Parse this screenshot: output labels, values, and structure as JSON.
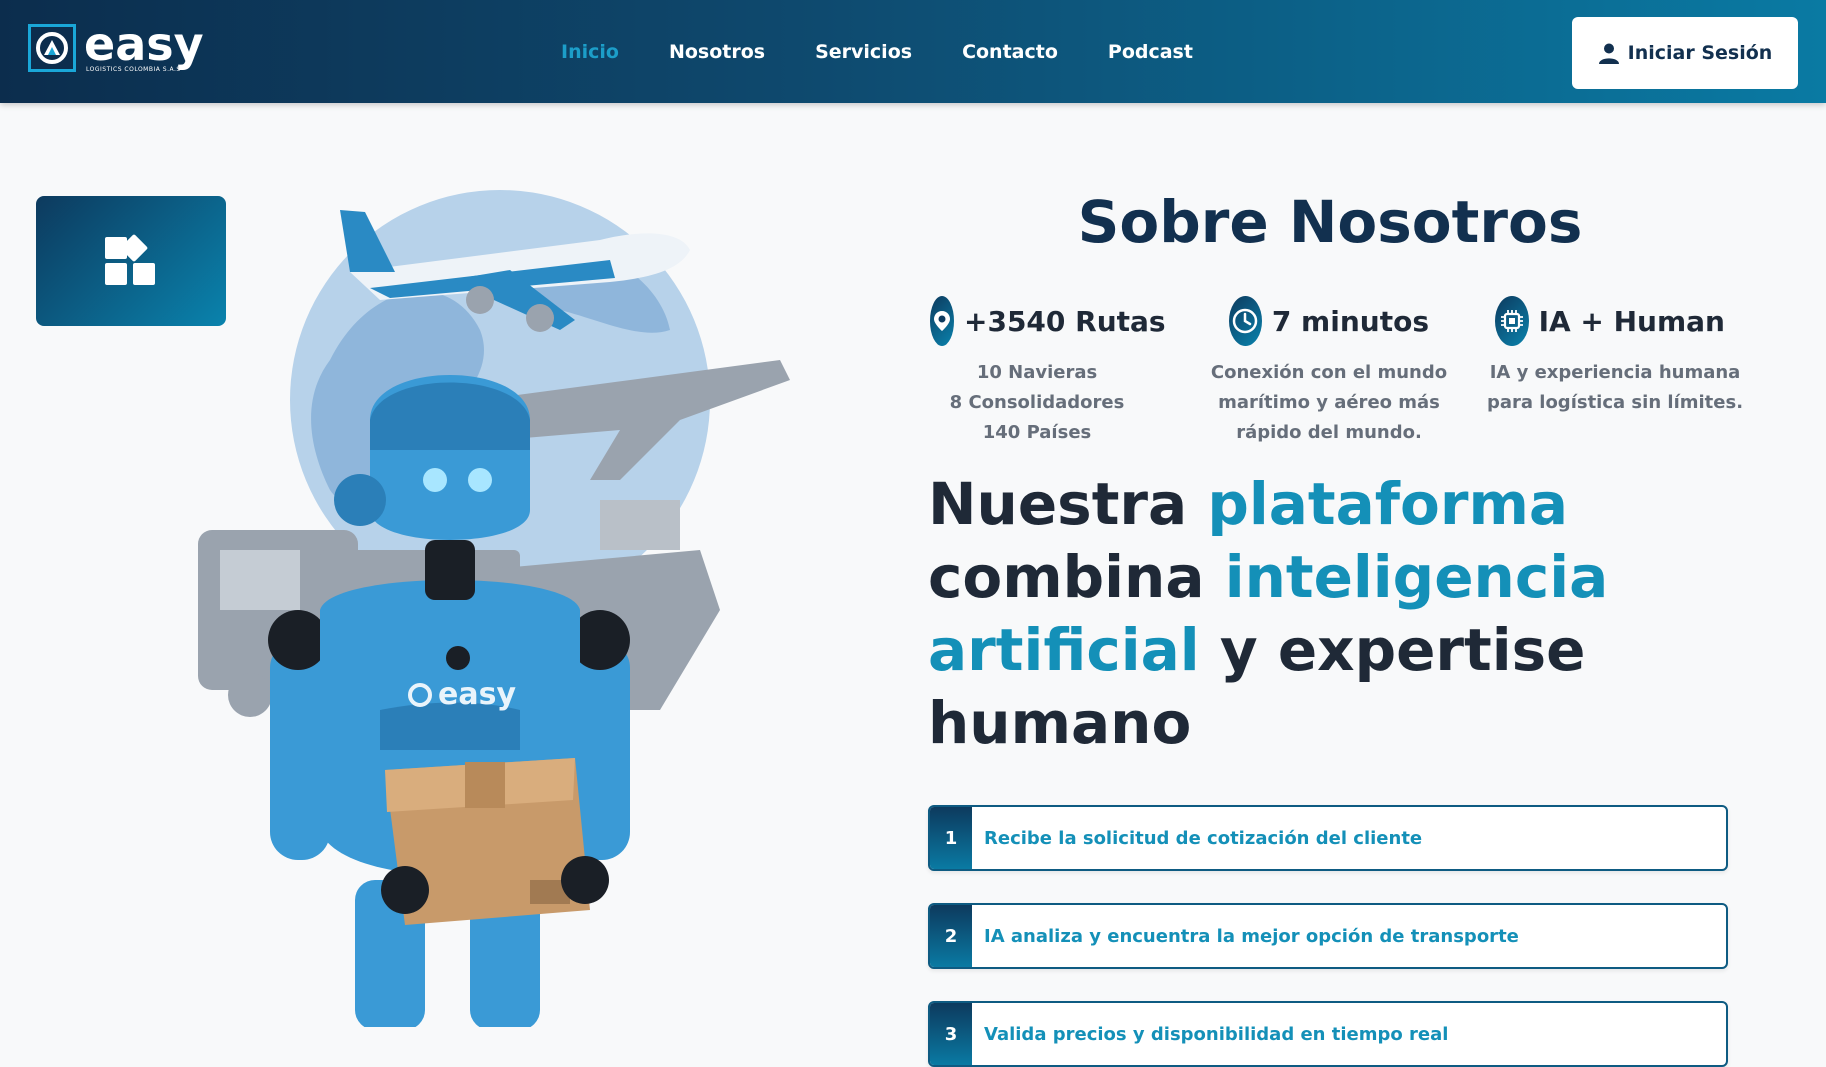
{
  "navbar": {
    "logo_text": "easy",
    "logo_subtitle": "LOGISTICS COLOMBIA S.A.S",
    "links": [
      {
        "label": "Inicio",
        "active": true
      },
      {
        "label": "Nosotros",
        "active": false
      },
      {
        "label": "Servicios",
        "active": false
      },
      {
        "label": "Contacto",
        "active": false
      },
      {
        "label": "Podcast",
        "active": false
      }
    ],
    "login_label": "Iniciar Sesión",
    "login_icon": "user-icon"
  },
  "app_box": {
    "icon": "widgets-icon"
  },
  "hero": {
    "robot_brand": "easy"
  },
  "about": {
    "title": "Sobre Nosotros",
    "stats": [
      {
        "icon": "location-pin-icon",
        "title": "+3540 Rutas",
        "lines": [
          "10 Navieras",
          "8 Consolidadores",
          "140 Países"
        ]
      },
      {
        "icon": "clock-icon",
        "title": "7 minutos",
        "lines": [
          "Conexión con el mundo",
          "marítimo y aéreo más",
          "rápido del mundo."
        ]
      },
      {
        "icon": "chip-icon",
        "title": "IA + Human",
        "lines": [
          "IA y experiencia humana",
          "para logística sin límites."
        ]
      }
    ]
  },
  "headline": {
    "parts": [
      {
        "text": "Nuestra ",
        "highlight": false
      },
      {
        "text": "plataforma",
        "highlight": true
      },
      {
        "text": " combina ",
        "highlight": false
      },
      {
        "text": "inteligencia artificial",
        "highlight": true
      },
      {
        "text": " y expertise humano",
        "highlight": false
      }
    ]
  },
  "steps": [
    {
      "number": "1",
      "text": "Recibe la solicitud de cotización del cliente"
    },
    {
      "number": "2",
      "text": "IA analiza y encuentra la mejor opción de transporte"
    },
    {
      "number": "3",
      "text": "Valida precios y disponibilidad en tiempo real"
    }
  ],
  "colors": {
    "navy": "#12304f",
    "accent": "#1490b8",
    "nav_active": "#1c9ec9"
  }
}
